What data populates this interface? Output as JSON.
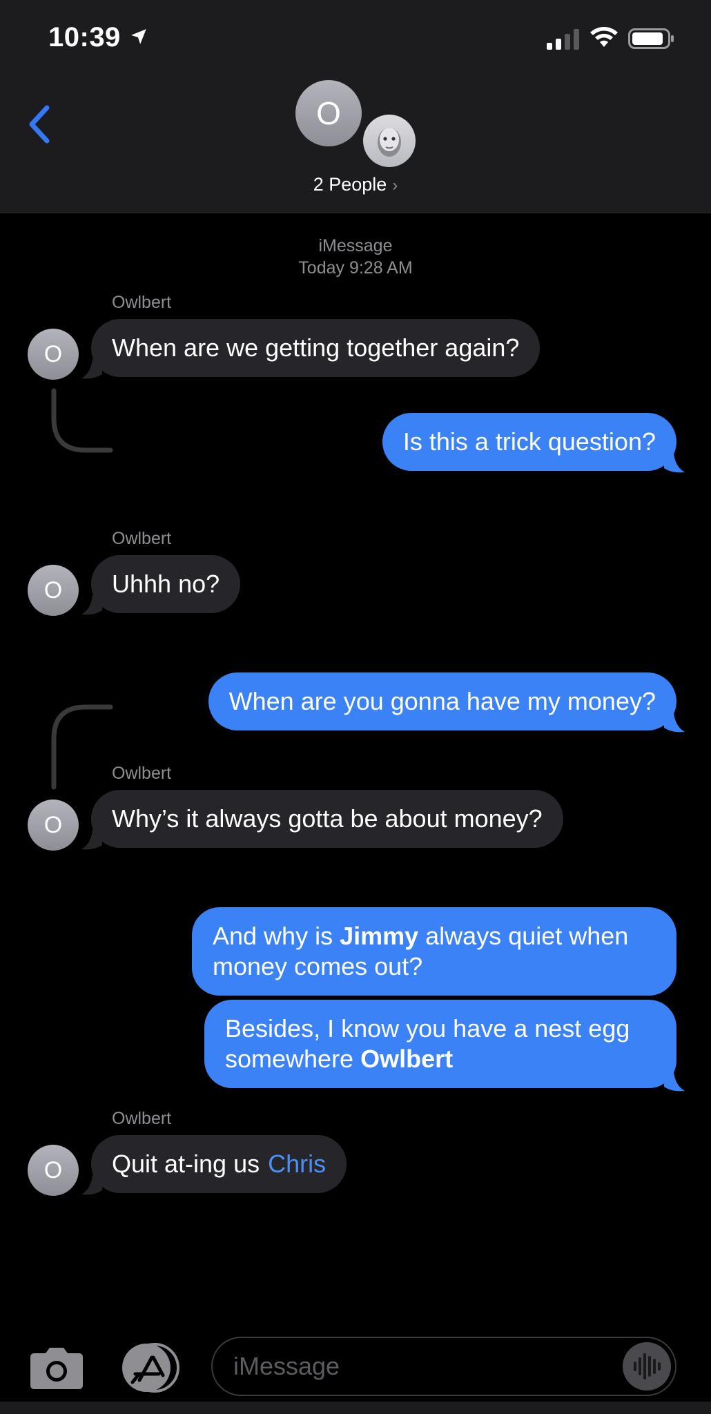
{
  "status_bar": {
    "time": "10:39"
  },
  "header": {
    "group_initial": "O",
    "people_label": "2 People"
  },
  "thread": {
    "service": "iMessage",
    "timestamp": "Today 9:28 AM",
    "messages": [
      {
        "sender": "Owlbert",
        "avatar_initial": "O",
        "text": "When are we getting together again?"
      },
      {
        "text": "Is this a trick question?"
      },
      {
        "sender": "Owlbert",
        "avatar_initial": "O",
        "text": "Uhhh no?"
      },
      {
        "text": "When are you gonna have my money?"
      },
      {
        "sender": "Owlbert",
        "avatar_initial": "O",
        "text": "Why’s it always gotta be about money?"
      },
      {
        "text_a": "And why is ",
        "bold": "Jimmy",
        "text_b": " always quiet when money comes out?"
      },
      {
        "text_a": "Besides, I know you have a nest egg somewhere ",
        "bold": "Owlbert"
      },
      {
        "sender": "Owlbert",
        "avatar_initial": "O",
        "text": "Quit at-ing us",
        "mention": "Chris"
      }
    ]
  },
  "composer": {
    "placeholder": "iMessage"
  },
  "colors": {
    "outgoing_bubble": "#3b82f6",
    "incoming_bubble": "#26262a",
    "accent": "#3478f6",
    "background": "#000000"
  }
}
